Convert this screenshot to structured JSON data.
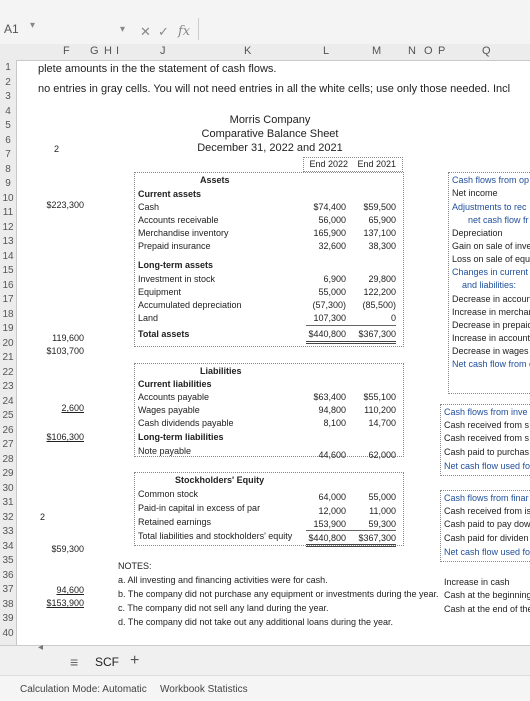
{
  "formula_bar": {
    "cell_ref": "A1",
    "cancel_icon": "✕",
    "enter_icon": "✓",
    "fx_label": "fx"
  },
  "columns": [
    "F",
    "G",
    "H",
    "I",
    "J",
    "K",
    "L",
    "M",
    "N",
    "O",
    "P",
    "Q"
  ],
  "rows": [
    "1",
    "2",
    "3",
    "4",
    "5",
    "6",
    "7",
    "8",
    "9",
    "10",
    "11",
    "12",
    "13",
    "14",
    "15",
    "16",
    "17",
    "18",
    "19",
    "20",
    "21",
    "22",
    "23",
    "24",
    "25",
    "26",
    "27",
    "28",
    "29",
    "30",
    "31",
    "32",
    "33",
    "34",
    "35",
    "36",
    "37",
    "38",
    "39",
    "40"
  ],
  "instructions": {
    "line1": "plete amounts in the the statement of cash flows.",
    "line2": "no entries in gray cells. You will not need entries in all the white cells; use only those needed. Incl"
  },
  "header": {
    "company": "Morris Company",
    "title": "Comparative Balance Sheet",
    "date": "December 31, 2022 and 2021",
    "col_2022": "End 2022",
    "col_2021": "End 2021"
  },
  "left_col": {
    "r6": "2",
    "r10": "$223,300",
    "r19": "119,600",
    "r20": "$103,700",
    "r24": "2,600",
    "r26": "$106,300",
    "r32": "2",
    "r34": "$59,300",
    "r37": "94,600",
    "r38": "$153,900"
  },
  "assets": {
    "heading": "Assets",
    "current_label": "Current assets",
    "rows": [
      {
        "label": "Cash",
        "v2022": "$74,400",
        "v2021": "$59,500"
      },
      {
        "label": "Accounts receivable",
        "v2022": "56,000",
        "v2021": "65,900"
      },
      {
        "label": "Merchandise inventory",
        "v2022": "165,900",
        "v2021": "137,100"
      },
      {
        "label": "Prepaid insurance",
        "v2022": "32,600",
        "v2021": "38,300"
      }
    ],
    "longterm_label": "Long-term assets",
    "lt_rows": [
      {
        "label": "Investment in stock",
        "v2022": "6,900",
        "v2021": "29,800"
      },
      {
        "label": "Equipment",
        "v2022": "55,000",
        "v2021": "122,200"
      },
      {
        "label": "Accumulated depreciation",
        "v2022": "(57,300)",
        "v2021": "(85,500)"
      },
      {
        "label": "Land",
        "v2022": "107,300",
        "v2021": "0"
      }
    ],
    "total": {
      "label": "Total assets",
      "v2022": "$440,800",
      "v2021": "$367,300"
    }
  },
  "liabilities": {
    "heading": "Liabilities",
    "current_label": "Current liabilities",
    "rows": [
      {
        "label": "Accounts payable",
        "v2022": "$63,400",
        "v2021": "$55,100"
      },
      {
        "label": "Wages payable",
        "v2022": "94,800",
        "v2021": "110,200"
      },
      {
        "label": "Cash dividends payable",
        "v2022": "8,100",
        "v2021": "14,700"
      }
    ],
    "longterm_label": "Long-term liabilities",
    "lt_rows": [
      {
        "label": "Note payable",
        "v2022": "44,600",
        "v2021": "62,000"
      }
    ]
  },
  "equity": {
    "heading": "Stockholders' Equity",
    "rows": [
      {
        "label": "Common stock",
        "v2022": "64,000",
        "v2021": "55,000"
      },
      {
        "label": "Paid-in capital in excess of par",
        "v2022": "12,000",
        "v2021": "11,000"
      },
      {
        "label": "Retained earnings",
        "v2022": "153,900",
        "v2021": "59,300"
      }
    ],
    "total": {
      "label": "Total liabilities and stockholders' equity",
      "v2022": "$440,800",
      "v2021": "$367,300"
    }
  },
  "notes": {
    "heading": "NOTES:",
    "items": [
      "a.  All investing and financing activities were for cash.",
      "b.  The company did not purchase any equipment or investments during the year.",
      "c.  The company did not sell any land during the year.",
      "d.  The company did not take out any additional loans during the year."
    ]
  },
  "cash_flow": {
    "operating": [
      "Cash flows from op",
      "Net income",
      "Adjustments to rec",
      "net cash flow fr",
      "Depreciation",
      "Gain on sale of inve",
      "Loss on sale of equ",
      "Changes in current",
      "and liabilities:",
      "Decrease in accoun",
      "Increase in merchar",
      "Decrease in prepaid",
      "Increase in accounts",
      "Decrease in wages p",
      "Net cash flow from o"
    ],
    "investing": [
      "Cash flows from inve",
      "Cash received from s",
      "Cash received from s",
      "Cash paid to purchas",
      "Net cash flow used fo"
    ],
    "financing": [
      "Cash flows from finar",
      "Cash received from is",
      "Cash paid to pay dow",
      "Cash paid for dividen",
      "Net cash flow used fo"
    ],
    "summary": [
      "Increase in cash",
      "Cash at the beginning",
      "Cash at the end of the"
    ]
  },
  "tabs": {
    "add_label": "+",
    "active": "SCF"
  },
  "status": {
    "calc_mode": "Calculation Mode: Automatic",
    "stats": "Workbook Statistics"
  }
}
